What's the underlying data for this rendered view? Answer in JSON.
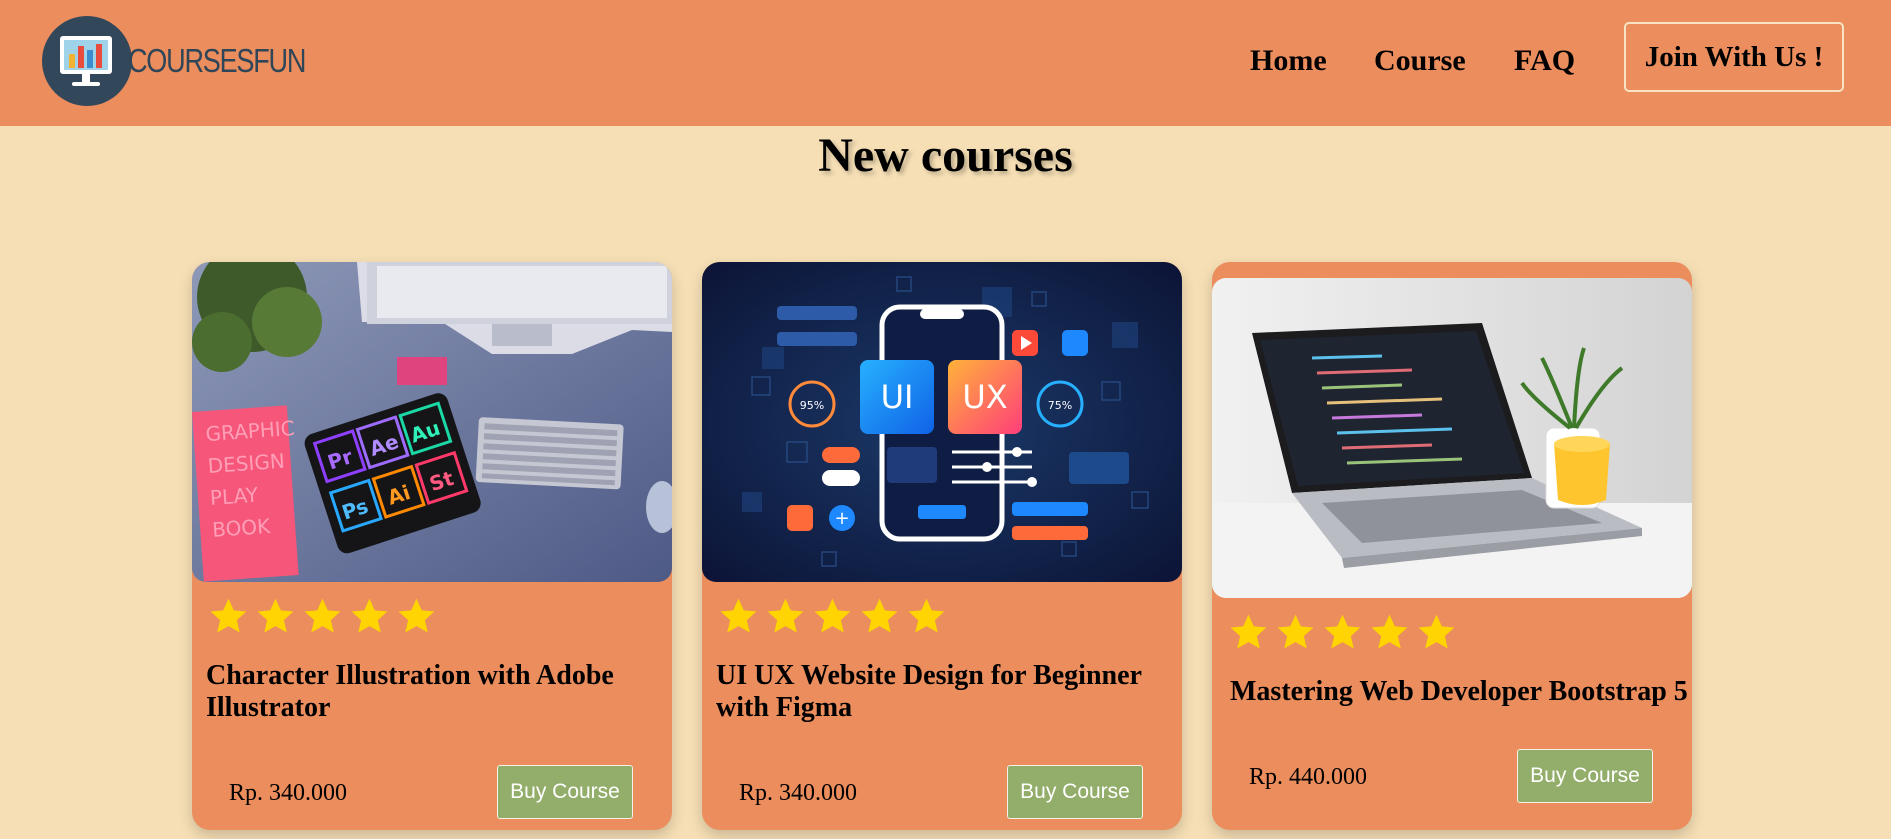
{
  "brand": {
    "name": "COURSESFUN"
  },
  "nav": {
    "links": [
      "Home",
      "Course",
      "FAQ"
    ],
    "cta_label": "Join With Us !"
  },
  "section": {
    "title": "New courses"
  },
  "rating_icon": "star-icon",
  "courses": [
    {
      "title": "Character Illustration with Adobe Illustrator",
      "rating": 5,
      "price": "Rp. 340.000",
      "button_label": "Buy Course",
      "image_subject": "desk with tablet showing Adobe app icons",
      "image_icons": [
        "Pr",
        "Ae",
        "Au",
        "Ps",
        "Ai",
        "St"
      ],
      "image_book_text": [
        "GRAPHIC",
        "DESIGN",
        "PLAY",
        "BOOK"
      ]
    },
    {
      "title": "UI UX Website Design for Beginner with Figma",
      "rating": 5,
      "price": "Rp. 340.000",
      "button_label": "Buy Course",
      "image_subject": "phone UI/UX illustration",
      "image_labels": [
        "UI",
        "UX",
        "95%",
        "75%"
      ]
    },
    {
      "title": "Mastering Web Developer Bootstrap 5",
      "rating": 5,
      "price": "Rp. 440.000",
      "button_label": "Buy Course",
      "image_subject": "laptop with code editor and yellow mug"
    }
  ],
  "colors": {
    "page_bg": "#f6dfb5",
    "nav_bg": "#eb8d5c",
    "card_bg": "#eb8d5c",
    "button_bg": "#93ad6a",
    "star": "#ffd400"
  }
}
